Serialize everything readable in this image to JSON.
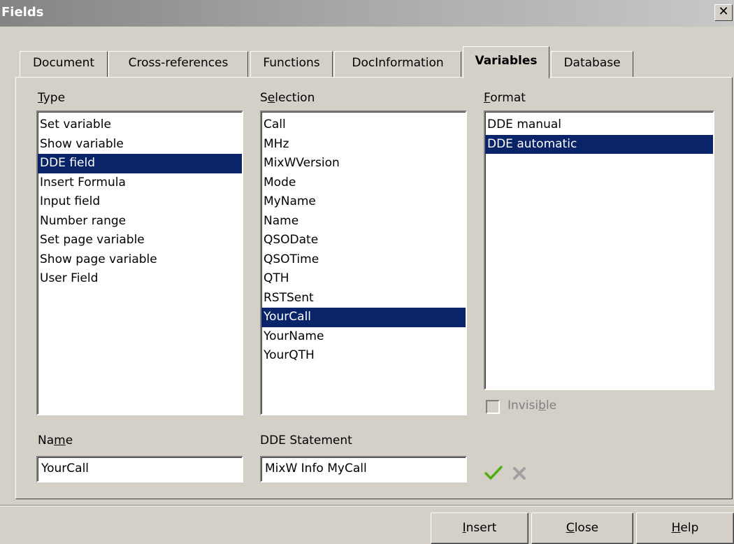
{
  "window": {
    "title": "Fields",
    "close_label": "✕"
  },
  "tabs": [
    {
      "label": "Document",
      "active": false
    },
    {
      "label": "Cross-references",
      "active": false
    },
    {
      "label": "Functions",
      "active": false
    },
    {
      "label": "DocInformation",
      "active": false
    },
    {
      "label": "Variables",
      "active": true
    },
    {
      "label": "Database",
      "active": false
    }
  ],
  "type": {
    "label_pre": "",
    "label_accel": "T",
    "label_post": "ype",
    "items": [
      "Set variable",
      "Show variable",
      "DDE field",
      "Insert Formula",
      "Input field",
      "Number range",
      "Set page variable",
      "Show page variable",
      "User Field"
    ],
    "selected": "DDE field"
  },
  "selection": {
    "label_pre": "S",
    "label_accel": "e",
    "label_post": "lection",
    "items": [
      "Call",
      "MHz",
      "MixWVersion",
      "Mode",
      "MyName",
      "Name",
      "QSODate",
      "QSOTime",
      "QTH",
      "RSTSent",
      "YourCall",
      "YourName",
      "YourQTH"
    ],
    "selected": "YourCall"
  },
  "format": {
    "label_pre": "",
    "label_accel": "F",
    "label_post": "ormat",
    "items": [
      "DDE manual",
      "DDE automatic"
    ],
    "selected": "DDE automatic"
  },
  "invisible": {
    "label_pre": "Invisi",
    "label_accel": "b",
    "label_post": "le",
    "checked": false,
    "enabled": false
  },
  "name": {
    "label_pre": "Na",
    "label_accel": "m",
    "label_post": "e",
    "value": "YourCall"
  },
  "dde_statement": {
    "label": "DDE Statement",
    "value": "MixW Info MyCall"
  },
  "icons": {
    "apply": "checkmark-icon",
    "discard": "cross-icon",
    "apply_color": "#6abf2a",
    "discard_color": "#a0a0a0"
  },
  "buttons": {
    "insert": {
      "pre": "",
      "accel": "I",
      "post": "nsert"
    },
    "close": {
      "pre": "",
      "accel": "C",
      "post": "lose"
    },
    "help": {
      "pre": "",
      "accel": "H",
      "post": "elp"
    }
  }
}
